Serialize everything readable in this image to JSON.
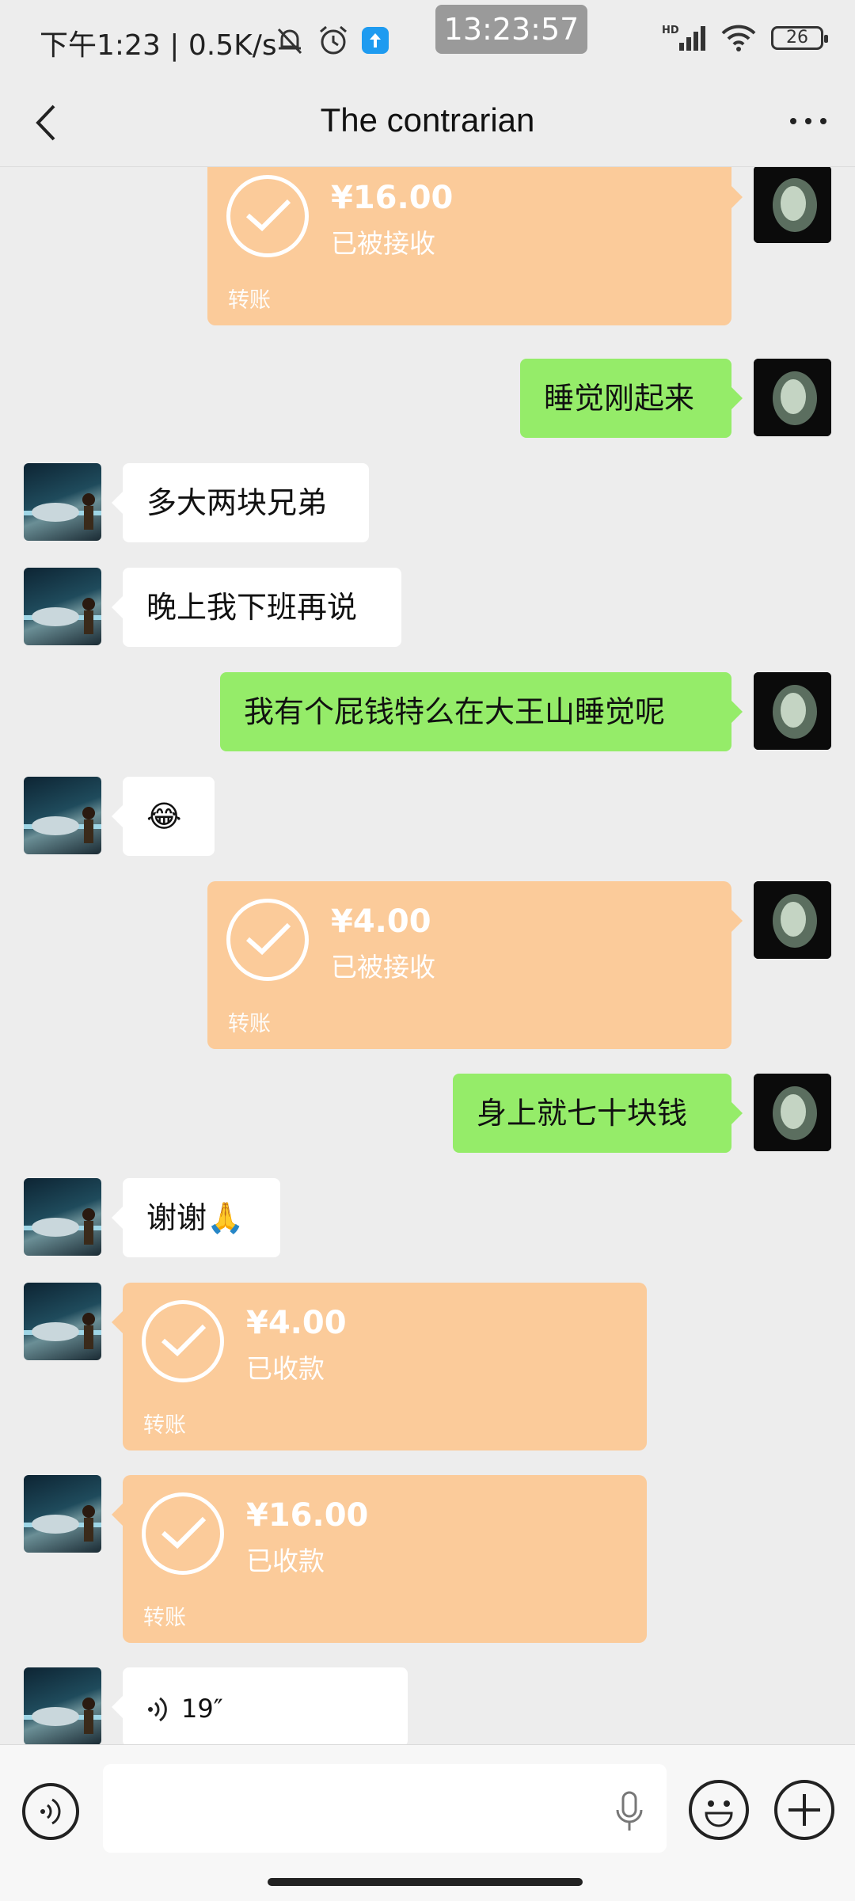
{
  "status_bar": {
    "left_text": "下午1:23 | 0.5K/s",
    "overlay_time": "13:23:57",
    "network_label": "HD",
    "battery": "26"
  },
  "nav": {
    "title": "The contrarian"
  },
  "messages": [
    {
      "side": "self",
      "type": "transfer",
      "amount": "¥16.00",
      "status": "已被接收",
      "label": "转账"
    },
    {
      "side": "self",
      "type": "text",
      "text": "睡觉刚起来"
    },
    {
      "side": "other",
      "type": "text",
      "text": "多大两块兄弟"
    },
    {
      "side": "other",
      "type": "text",
      "text": "晚上我下班再说"
    },
    {
      "side": "self",
      "type": "text",
      "text": "我有个屁钱特么在大王山睡觉呢"
    },
    {
      "side": "other",
      "type": "text",
      "text": "😂"
    },
    {
      "side": "self",
      "type": "transfer",
      "amount": "¥4.00",
      "status": "已被接收",
      "label": "转账"
    },
    {
      "side": "self",
      "type": "text",
      "text": "身上就七十块钱"
    },
    {
      "side": "other",
      "type": "text",
      "text": "谢谢🙏"
    },
    {
      "side": "other",
      "type": "transfer",
      "amount": "¥4.00",
      "status": "已收款",
      "label": "转账"
    },
    {
      "side": "other",
      "type": "transfer",
      "amount": "¥16.00",
      "status": "已收款",
      "label": "转账"
    },
    {
      "side": "other",
      "type": "voice",
      "duration": "19″"
    }
  ],
  "colors": {
    "background": "#ededed",
    "self_bubble": "#95ec69",
    "other_bubble": "#ffffff",
    "transfer_card": "#fbcb9a"
  },
  "input_bar": {
    "value": "",
    "icons": [
      "voice-mode-icon",
      "microphone-icon",
      "emoji-icon",
      "plus-icon"
    ]
  }
}
